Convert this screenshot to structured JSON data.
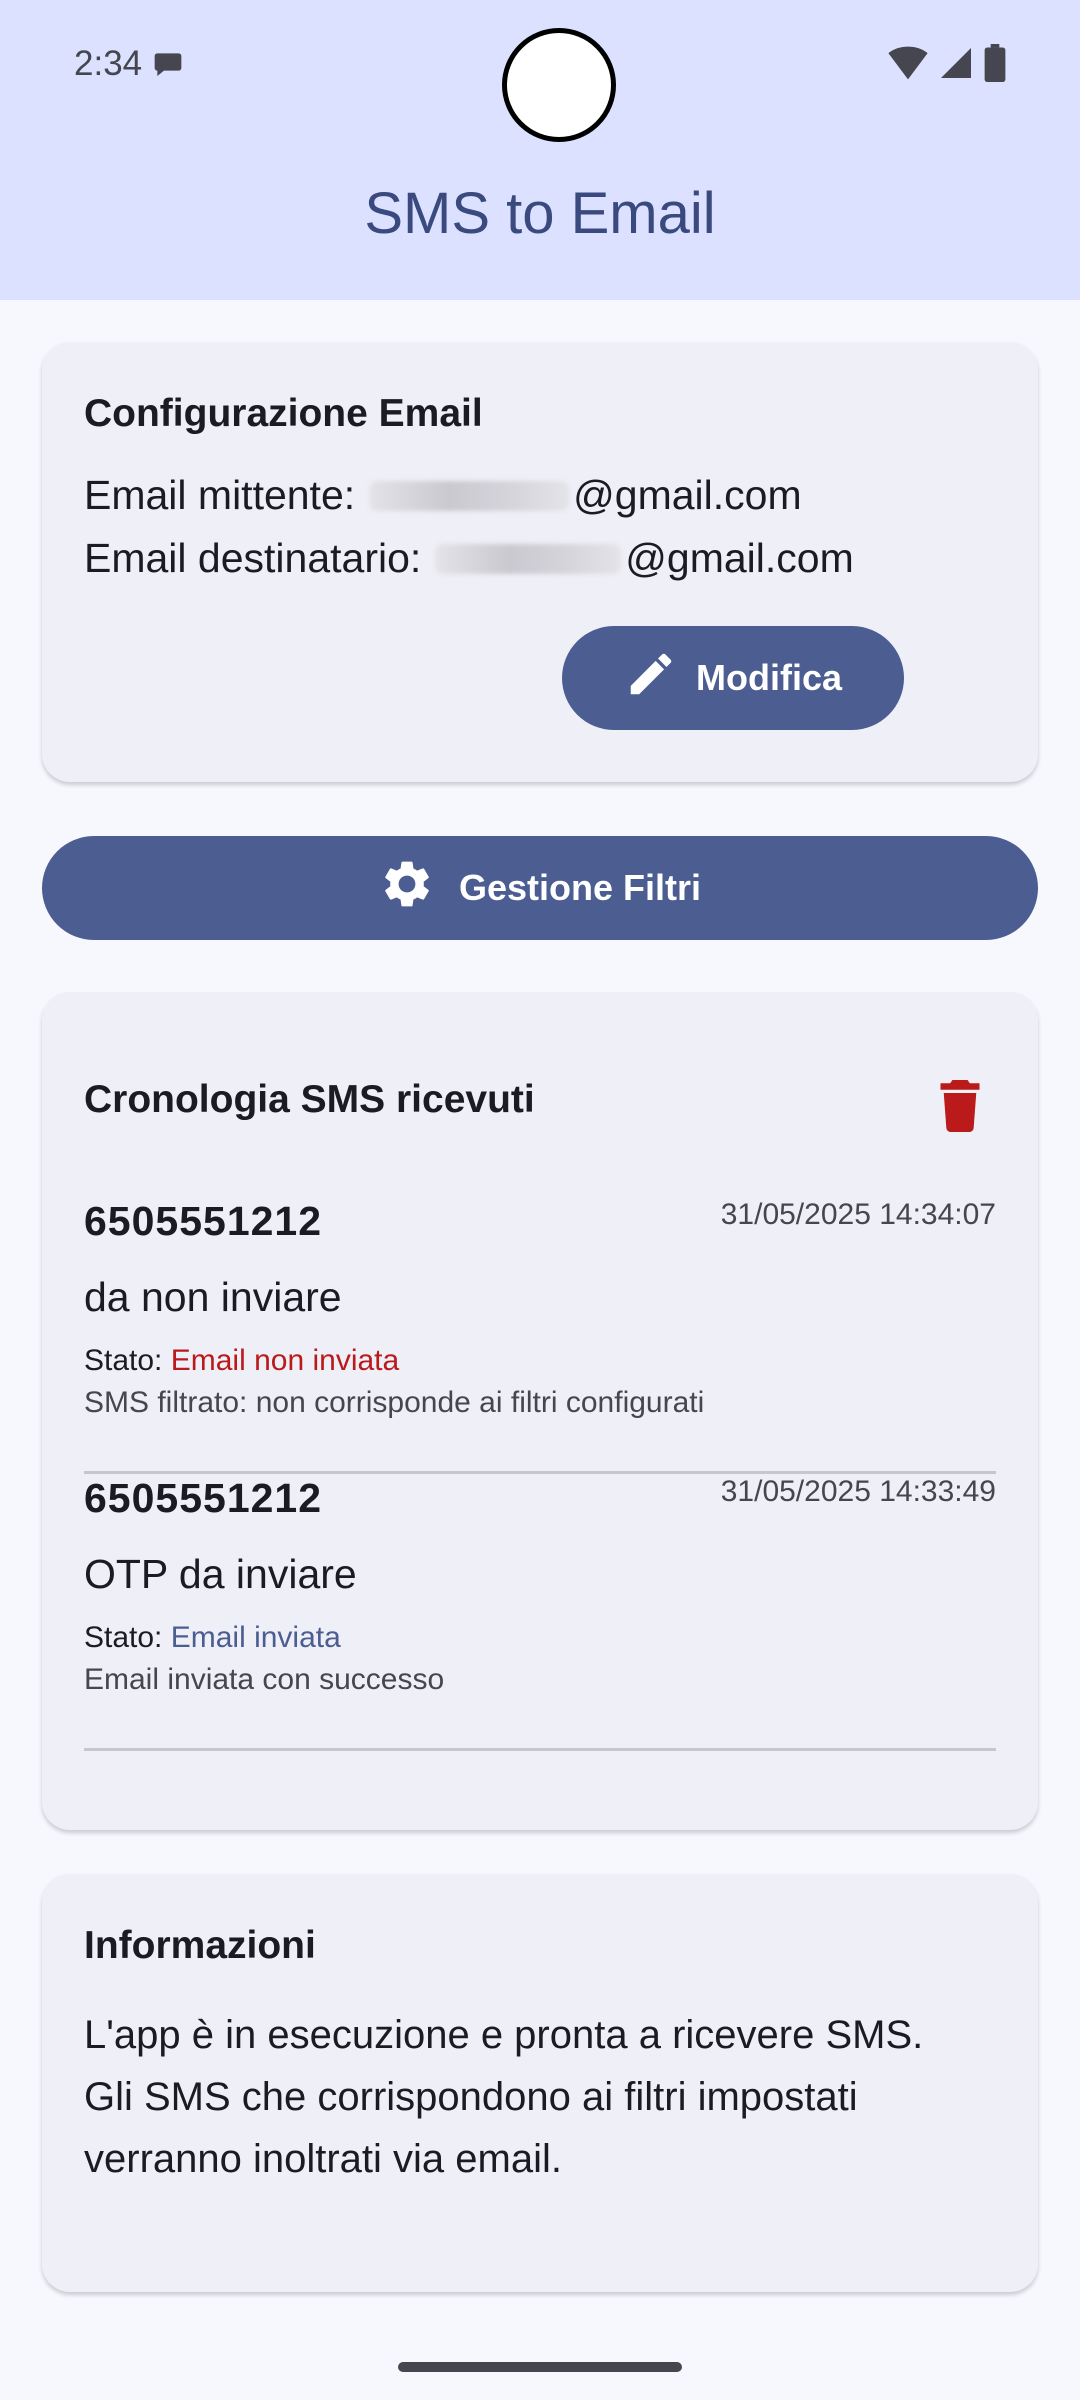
{
  "status_bar": {
    "time": "2:34",
    "icons": [
      "chat-bubble-icon",
      "wifi-icon",
      "cellular-signal-icon",
      "battery-icon"
    ]
  },
  "app_bar": {
    "title": "SMS to Email"
  },
  "config_card": {
    "title": "Configurazione Email",
    "sender_label": "Email mittente:",
    "sender_domain": "@gmail.com",
    "recipient_label": "Email destinatario:",
    "recipient_domain": "@gmail.com",
    "modify_button": "Modifica",
    "modify_icon": "pencil-icon"
  },
  "filters_button": {
    "label": "Gestione Filtri",
    "icon": "gear-icon"
  },
  "history_card": {
    "title": "Cronologia SMS ricevuti",
    "clear_icon": "trash-icon",
    "items": [
      {
        "number": "6505551212",
        "timestamp": "31/05/2025 14:34:07",
        "body": "da non inviare",
        "status_label": "Stato:",
        "status_value": "Email non inviata",
        "detail": "SMS filtrato: non corrisponde ai filtri configurati"
      },
      {
        "number": "6505551212",
        "timestamp": "31/05/2025 14:33:49",
        "body": "OTP da inviare",
        "status_label": "Stato:",
        "status_value": "Email inviata",
        "detail": "Email inviata con successo"
      }
    ]
  },
  "info_card": {
    "title": "Informazioni",
    "line1": "L'app è in esecuzione e pronta a ricevere SMS.",
    "line2": "Gli SMS che corrispondono ai filtri impostati verranno inoltrati via email."
  },
  "colors": {
    "app_bar_bg": "#dbe1ff",
    "primary": "#4b5d91",
    "error": "#ba1a1a",
    "card_bg": "#efeff7"
  }
}
